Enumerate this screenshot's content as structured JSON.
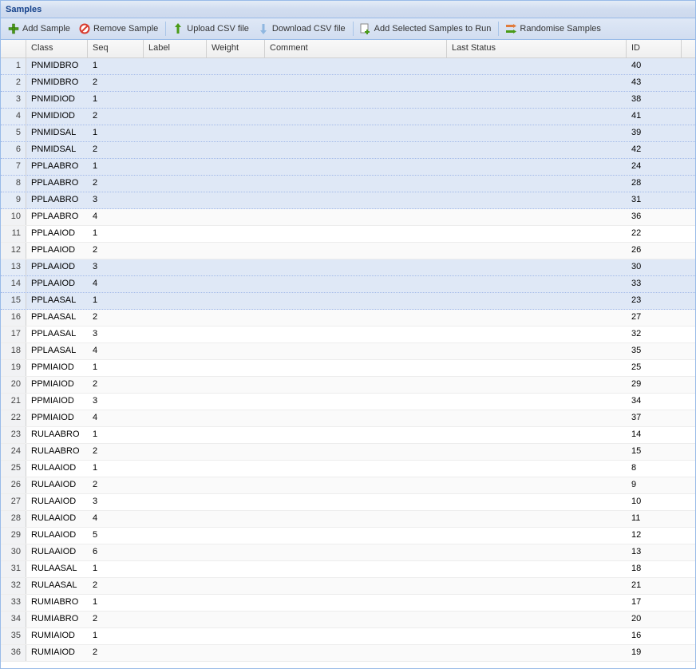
{
  "panel": {
    "title": "Samples"
  },
  "toolbar": {
    "add": "Add Sample",
    "remove": "Remove Sample",
    "upload": "Upload CSV file",
    "download": "Download CSV file",
    "addToRun": "Add Selected Samples to Run",
    "randomise": "Randomise Samples"
  },
  "columns": {
    "class": "Class",
    "seq": "Seq",
    "label": "Label",
    "weight": "Weight",
    "comment": "Comment",
    "status": "Last Status",
    "id": "ID"
  },
  "rows": [
    {
      "n": 1,
      "class": "PNMIDBRO",
      "seq": 1,
      "id": 40,
      "sel": true
    },
    {
      "n": 2,
      "class": "PNMIDBRO",
      "seq": 2,
      "id": 43,
      "sel": true
    },
    {
      "n": 3,
      "class": "PNMIDIOD",
      "seq": 1,
      "id": 38,
      "sel": true
    },
    {
      "n": 4,
      "class": "PNMIDIOD",
      "seq": 2,
      "id": 41,
      "sel": true
    },
    {
      "n": 5,
      "class": "PNMIDSAL",
      "seq": 1,
      "id": 39,
      "sel": true
    },
    {
      "n": 6,
      "class": "PNMIDSAL",
      "seq": 2,
      "id": 42,
      "sel": true
    },
    {
      "n": 7,
      "class": "PPLAABRO",
      "seq": 1,
      "id": 24,
      "sel": true
    },
    {
      "n": 8,
      "class": "PPLAABRO",
      "seq": 2,
      "id": 28,
      "sel": true
    },
    {
      "n": 9,
      "class": "PPLAABRO",
      "seq": 3,
      "id": 31,
      "sel": true
    },
    {
      "n": 10,
      "class": "PPLAABRO",
      "seq": 4,
      "id": 36,
      "sel": false
    },
    {
      "n": 11,
      "class": "PPLAAIOD",
      "seq": 1,
      "id": 22,
      "sel": false
    },
    {
      "n": 12,
      "class": "PPLAAIOD",
      "seq": 2,
      "id": 26,
      "sel": false
    },
    {
      "n": 13,
      "class": "PPLAAIOD",
      "seq": 3,
      "id": 30,
      "sel": true
    },
    {
      "n": 14,
      "class": "PPLAAIOD",
      "seq": 4,
      "id": 33,
      "sel": true
    },
    {
      "n": 15,
      "class": "PPLAASAL",
      "seq": 1,
      "id": 23,
      "sel": true
    },
    {
      "n": 16,
      "class": "PPLAASAL",
      "seq": 2,
      "id": 27,
      "sel": false
    },
    {
      "n": 17,
      "class": "PPLAASAL",
      "seq": 3,
      "id": 32,
      "sel": false
    },
    {
      "n": 18,
      "class": "PPLAASAL",
      "seq": 4,
      "id": 35,
      "sel": false
    },
    {
      "n": 19,
      "class": "PPMIAIOD",
      "seq": 1,
      "id": 25,
      "sel": false
    },
    {
      "n": 20,
      "class": "PPMIAIOD",
      "seq": 2,
      "id": 29,
      "sel": false
    },
    {
      "n": 21,
      "class": "PPMIAIOD",
      "seq": 3,
      "id": 34,
      "sel": false
    },
    {
      "n": 22,
      "class": "PPMIAIOD",
      "seq": 4,
      "id": 37,
      "sel": false
    },
    {
      "n": 23,
      "class": "RULAABRO",
      "seq": 1,
      "id": 14,
      "sel": false
    },
    {
      "n": 24,
      "class": "RULAABRO",
      "seq": 2,
      "id": 15,
      "sel": false
    },
    {
      "n": 25,
      "class": "RULAAIOD",
      "seq": 1,
      "id": 8,
      "sel": false
    },
    {
      "n": 26,
      "class": "RULAAIOD",
      "seq": 2,
      "id": 9,
      "sel": false
    },
    {
      "n": 27,
      "class": "RULAAIOD",
      "seq": 3,
      "id": 10,
      "sel": false
    },
    {
      "n": 28,
      "class": "RULAAIOD",
      "seq": 4,
      "id": 11,
      "sel": false
    },
    {
      "n": 29,
      "class": "RULAAIOD",
      "seq": 5,
      "id": 12,
      "sel": false
    },
    {
      "n": 30,
      "class": "RULAAIOD",
      "seq": 6,
      "id": 13,
      "sel": false
    },
    {
      "n": 31,
      "class": "RULAASAL",
      "seq": 1,
      "id": 18,
      "sel": false
    },
    {
      "n": 32,
      "class": "RULAASAL",
      "seq": 2,
      "id": 21,
      "sel": false
    },
    {
      "n": 33,
      "class": "RUMIABRO",
      "seq": 1,
      "id": 17,
      "sel": false
    },
    {
      "n": 34,
      "class": "RUMIABRO",
      "seq": 2,
      "id": 20,
      "sel": false
    },
    {
      "n": 35,
      "class": "RUMIAIOD",
      "seq": 1,
      "id": 16,
      "sel": false
    },
    {
      "n": 36,
      "class": "RUMIAIOD",
      "seq": 2,
      "id": 19,
      "sel": false
    }
  ]
}
